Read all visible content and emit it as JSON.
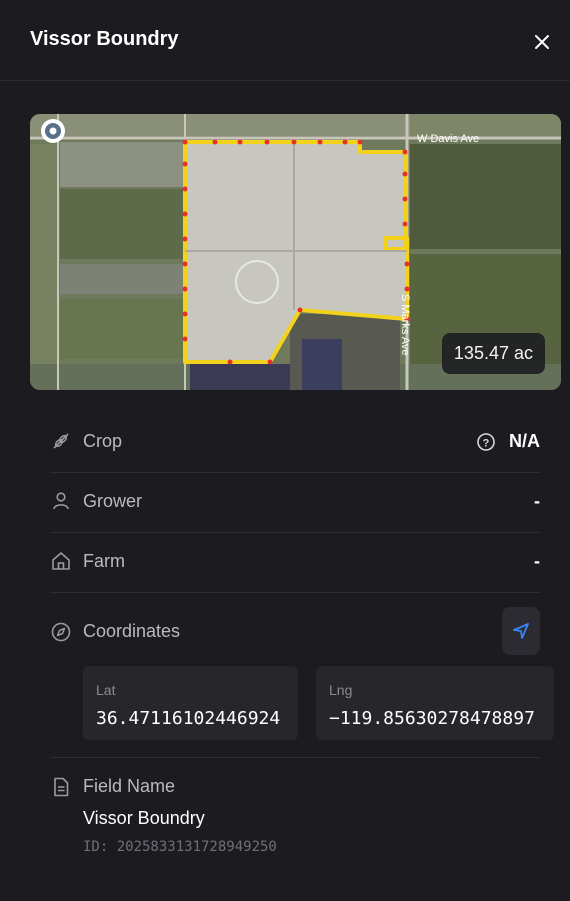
{
  "header": {
    "title": "Vissor Boundry",
    "close_icon": "close-icon"
  },
  "map": {
    "area": "135.47 ac",
    "road_labels": [
      "W Davis Ave",
      "S Marks Ave"
    ],
    "boundary_color": "#f2d21b",
    "vertex_color": "#e8302a"
  },
  "details": {
    "crop": {
      "label": "Crop",
      "value": "N/A",
      "icon": "crop-icon"
    },
    "grower": {
      "label": "Grower",
      "value": "-",
      "icon": "person-icon"
    },
    "farm": {
      "label": "Farm",
      "value": "-",
      "icon": "home-icon"
    },
    "coordinates": {
      "label": "Coordinates",
      "icon": "compass-icon",
      "lat_label": "Lat",
      "lat": "36.47116102446924",
      "lng_label": "Lng",
      "lng": "−119.85630278478897"
    }
  },
  "field": {
    "label": "Field Name",
    "name": "Vissor Boundry",
    "id": "ID: 2025833131728949250"
  },
  "colors": {
    "background": "#1c1c20",
    "accent": "#3b82f6"
  }
}
